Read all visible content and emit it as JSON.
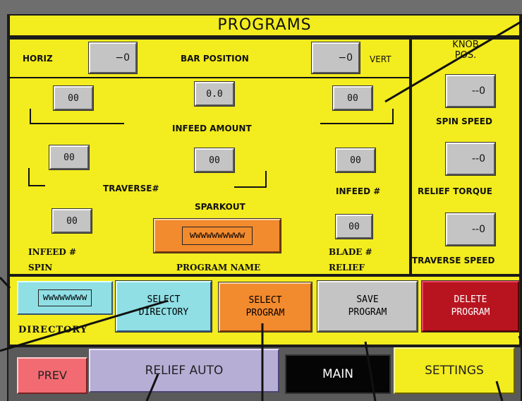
{
  "title": "PROGRAMS",
  "bar": {
    "horiz_label": "HORIZ",
    "horiz_value": "−0",
    "center_label": "BAR POSITION",
    "vert_value": "−0",
    "vert_label": "VERT"
  },
  "knob": {
    "header_line1": "KNOB",
    "header_line2": "POS.",
    "spin_value": "--0",
    "spin_label": "SPIN SPEED",
    "torque_value": "--0",
    "torque_label": "RELIEF TORQUE",
    "traverse_value": "--0",
    "traverse_label": "TRAVERSE SPEED"
  },
  "params": {
    "infeed_left_value": "00",
    "infeed_amount_value": "0.0",
    "infeed_right_value": "00",
    "infeed_amount_label": "INFEED AMOUNT",
    "traverse_left_value": "00",
    "traverse_center_value": "00",
    "traverse_label": "TRAVERSE#",
    "infeed_count_value": "00",
    "infeed_count_label": "INFEED #",
    "sparkout_label": "SPARKOUT",
    "spin_infeed_value": "00",
    "spin_infeed_label1": "INFEED #",
    "spin_infeed_label2": "SPIN",
    "program_name_value": "wwwwwwwwww",
    "program_name_label": "PROGRAM NAME",
    "blade_value": "00",
    "blade_label1": "BLADE #",
    "blade_label2": "RELIEF"
  },
  "directory": {
    "value": "wwwwwwww",
    "label": "DIRECTORY"
  },
  "actions": {
    "select_dir_1": "SELECT",
    "select_dir_2": "DIRECTORY",
    "select_prog_1": "SELECT",
    "select_prog_2": "PROGRAM",
    "save_1": "SAVE",
    "save_2": "PROGRAM",
    "delete_1": "DELETE",
    "delete_2": "PROGRAM"
  },
  "nav": {
    "prev": "PREV",
    "relief_auto": "RELIEF AUTO",
    "main": "MAIN",
    "settings": "SETTINGS"
  },
  "colors": {
    "panel": "#f3ec1e",
    "cyan": "#8fdfe5",
    "orange": "#f28a2e",
    "gray": "#c4c4c4",
    "red": "#b8141f",
    "pink": "#f36b72",
    "lavender": "#b7aed6",
    "black": "#050505"
  }
}
